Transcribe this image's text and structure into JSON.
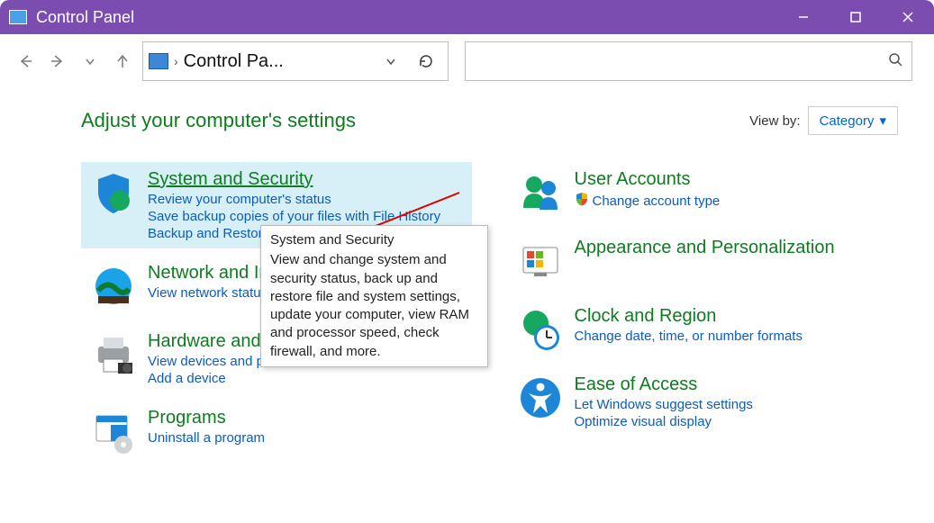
{
  "title": "Control Panel",
  "breadcrumb": "Control Pa...",
  "search_placeholder": "",
  "heading": "Adjust your computer's settings",
  "viewby_label": "View by:",
  "viewby_value": "Category",
  "categories_left": [
    {
      "title": "System and Security",
      "links": [
        "Review your computer's status",
        "Save backup copies of your files with File History",
        "Backup and Restore (Windows 7)"
      ],
      "highlight": true,
      "underline": true,
      "icon": "shield"
    },
    {
      "title": "Network and Internet",
      "links": [
        "View network status and tasks"
      ],
      "icon": "globe"
    },
    {
      "title": "Hardware and Sound",
      "links": [
        "View devices and printers",
        "Add a device"
      ],
      "icon": "printer"
    },
    {
      "title": "Programs",
      "links": [
        "Uninstall a program"
      ],
      "icon": "programs"
    }
  ],
  "categories_right": [
    {
      "title": "User Accounts",
      "links": [
        "Change account type"
      ],
      "shielded": [
        true
      ],
      "icon": "users"
    },
    {
      "title": "Appearance and Personalization",
      "links": [],
      "icon": "appearance"
    },
    {
      "title": "Clock and Region",
      "links": [
        "Change date, time, or number formats"
      ],
      "icon": "clock"
    },
    {
      "title": "Ease of Access",
      "links": [
        "Let Windows suggest settings",
        "Optimize visual display"
      ],
      "icon": "access"
    }
  ],
  "tooltip": {
    "title": "System and Security",
    "body": "View and change system and security status, back up and restore file and system settings, update your computer, view RAM and processor speed, check firewall, and more."
  }
}
